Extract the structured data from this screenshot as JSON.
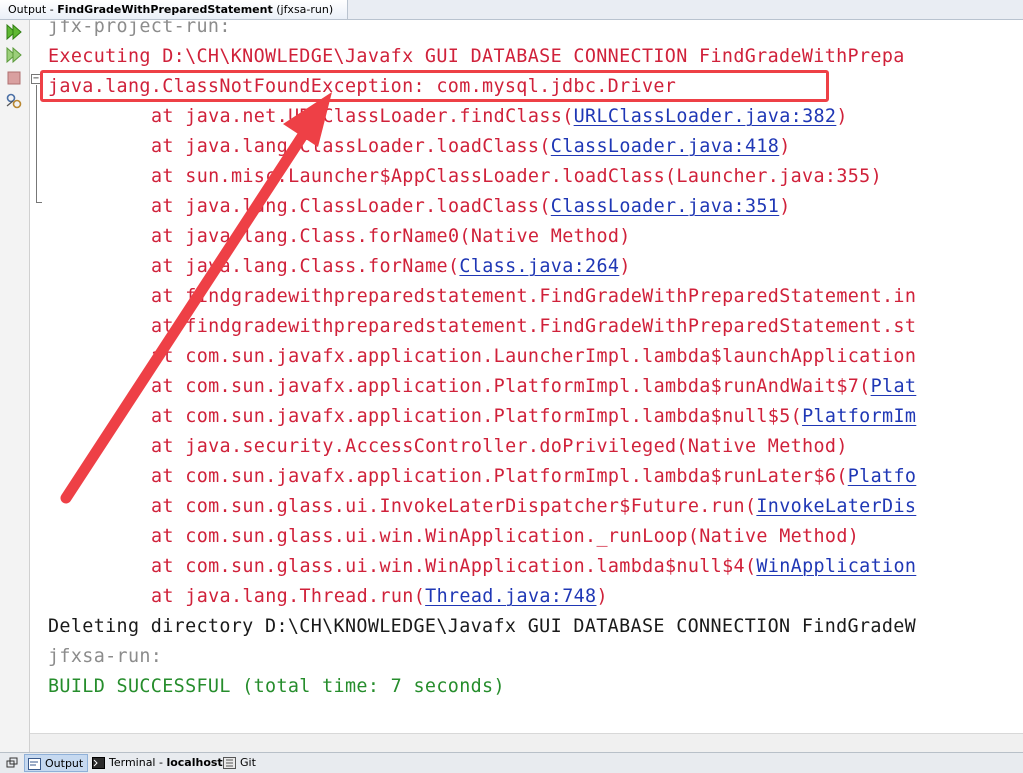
{
  "window": {
    "tab_prefix": "Output - ",
    "tab_bold": "FindGradeWithPreparedStatement",
    "tab_suffix": " (jfxsa-run)"
  },
  "toolbar": {
    "rerun": "rerun-icon",
    "rerun_options": "rerun-with-options-icon",
    "stop": "stop-icon",
    "settings": "settings-icon"
  },
  "console": {
    "project_run": "jfx-project-run:",
    "executing": "Executing D:\\CH\\KNOWLEDGE\\Javafx GUI DATABASE CONNECTION FindGradeWithPrepa",
    "exception": "java.lang.ClassNotFoundException: com.mysql.jdbc.Driver",
    "stack": [
      {
        "text": "at java.net.URLClassLoader.findClass(",
        "link": "URLClassLoader.java:382",
        "tail": ")"
      },
      {
        "text": "at java.lang.ClassLoader.loadClass(",
        "link": "ClassLoader.java:418",
        "tail": ")"
      },
      {
        "text": "at sun.misc.Launcher$AppClassLoader.loadClass(Launcher.java:355)",
        "link": "",
        "tail": ""
      },
      {
        "text": "at java.lang.ClassLoader.loadClass(",
        "link": "ClassLoader.java:351",
        "tail": ")"
      },
      {
        "text": "at java.lang.Class.forName0(Native Method)",
        "link": "",
        "tail": ""
      },
      {
        "text": "at java.lang.Class.forName(",
        "link": "Class.java:264",
        "tail": ")"
      },
      {
        "text": "at findgradewithpreparedstatement.FindGradeWithPreparedStatement.in",
        "link": "",
        "tail": ""
      },
      {
        "text": "at findgradewithpreparedstatement.FindGradeWithPreparedStatement.st",
        "link": "",
        "tail": ""
      },
      {
        "text": "at com.sun.javafx.application.LauncherImpl.lambda$launchApplication",
        "link": "",
        "tail": ""
      },
      {
        "text": "at com.sun.javafx.application.PlatformImpl.lambda$runAndWait$7(",
        "link": "Plat",
        "tail": ""
      },
      {
        "text": "at com.sun.javafx.application.PlatformImpl.lambda$null$5(",
        "link": "PlatformIm",
        "tail": ""
      },
      {
        "text": "at java.security.AccessController.doPrivileged(Native Method)",
        "link": "",
        "tail": ""
      },
      {
        "text": "at com.sun.javafx.application.PlatformImpl.lambda$runLater$6(",
        "link": "Platfo",
        "tail": ""
      },
      {
        "text": "at com.sun.glass.ui.InvokeLaterDispatcher$Future.run(",
        "link": "InvokeLaterDis",
        "tail": ""
      },
      {
        "text": "at com.sun.glass.ui.win.WinApplication._runLoop(Native Method)",
        "link": "",
        "tail": ""
      },
      {
        "text": "at com.sun.glass.ui.win.WinApplication.lambda$null$4(",
        "link": "WinApplication",
        "tail": ""
      },
      {
        "text": "at java.lang.Thread.run(",
        "link": "Thread.java:748",
        "tail": ")"
      }
    ],
    "deleting": "Deleting directory D:\\CH\\KNOWLEDGE\\Javafx GUI DATABASE CONNECTION FindGradeW",
    "jfxsa_run": "jfxsa-run:",
    "build": "BUILD SUCCESSFUL (total time: 7 seconds)"
  },
  "statusbar": {
    "output": "Output",
    "terminal_prefix": "Terminal - ",
    "terminal_host": "localhost",
    "git": "Git"
  },
  "colors": {
    "error": "#d0213a",
    "link": "#1f37b5",
    "success": "#268d2c",
    "annotation": "#ee4046"
  }
}
